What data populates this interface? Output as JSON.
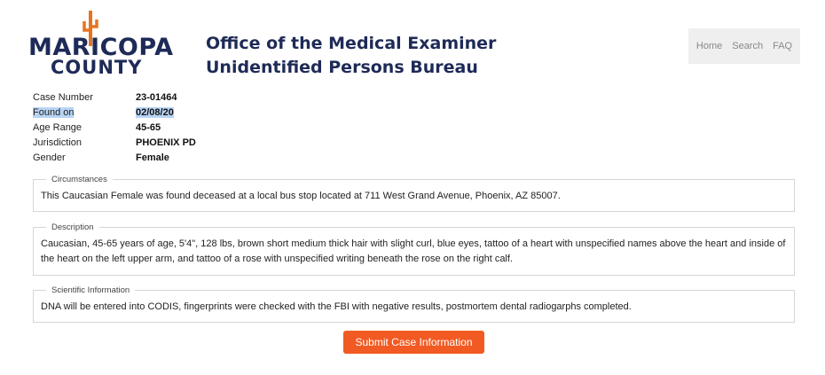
{
  "logo": {
    "line1": "MARICOPA",
    "line2": "COUNTY"
  },
  "title": {
    "line1": "Office of the Medical Examiner",
    "line2": "Unidentified Persons Bureau"
  },
  "nav": {
    "home": "Home",
    "search": "Search",
    "faq": "FAQ"
  },
  "case": {
    "case_number_label": "Case Number",
    "case_number": "23-01464",
    "found_on_label": "Found on",
    "found_on": "02/08/20",
    "age_range_label": "Age Range",
    "age_range": "45-65",
    "jurisdiction_label": "Jurisdiction",
    "jurisdiction": "PHOENIX PD",
    "gender_label": "Gender",
    "gender": "Female"
  },
  "circumstances": {
    "legend": "Circumstances",
    "text": "This Caucasian Female was found deceased at a local bus stop located at 711 West Grand Avenue, Phoenix, AZ 85007."
  },
  "description": {
    "legend": "Description",
    "text": "Caucasian, 45-65 years of age, 5'4\", 128 lbs, brown short medium thick hair with slight curl, blue eyes, tattoo of a heart with unspecified names above the heart and inside of the heart on the left upper arm, and tattoo of a rose with unspecified writing beneath the rose on the right calf."
  },
  "scientific": {
    "legend": "Scientific Information",
    "text": "DNA will be entered into CODIS, fingerprints were checked with the FBI with negative results, postmortem dental radiogarphs completed."
  },
  "submit_label": "Submit Case Information",
  "colors": {
    "brand_navy": "#1e2a57",
    "cactus_orange": "#e8731f",
    "submit_orange": "#f15a22",
    "selection": "#b8d4f5"
  },
  "icons": {
    "logo_mark": "saguaro-cactus-icon"
  }
}
